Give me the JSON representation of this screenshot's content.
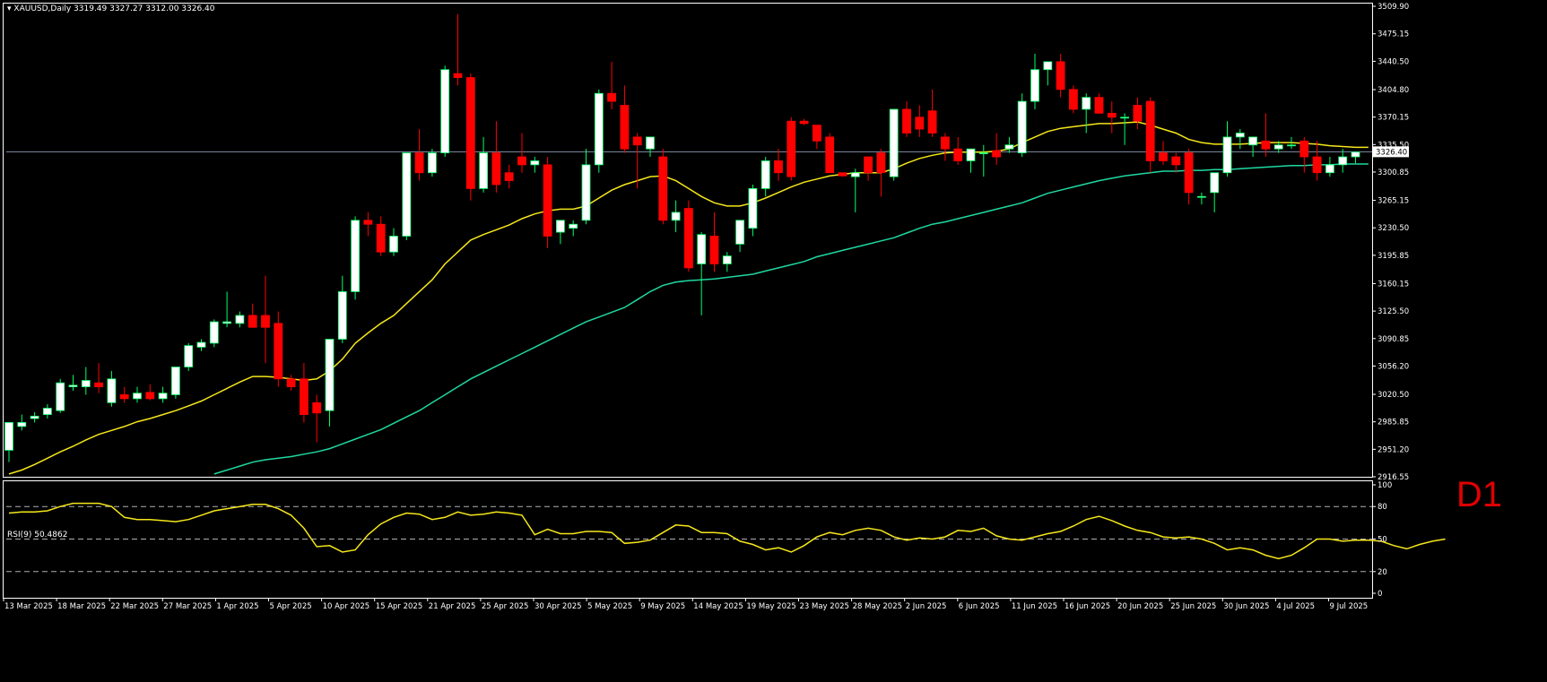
{
  "header": {
    "symbol_text": "XAUUSD,Daily  3319.49 3327.27 3312.00 3326.40"
  },
  "timeframe_label": "D1",
  "rsi": {
    "title": "RSI(9) 50.4862",
    "levels": [
      80,
      50,
      20
    ],
    "axis_labels": [
      "100",
      "80",
      "50",
      "20",
      "0"
    ],
    "color": "#f5e71a",
    "values": [
      74,
      75,
      75,
      76,
      80,
      83,
      83,
      83,
      80,
      70,
      68,
      68,
      67,
      66,
      68,
      72,
      76,
      78,
      80,
      82,
      82,
      78,
      72,
      60,
      43,
      44,
      38,
      40,
      54,
      64,
      70,
      74,
      73,
      68,
      70,
      75,
      72,
      73,
      75,
      74,
      72,
      54,
      59,
      55,
      55,
      57,
      57,
      56,
      46,
      47,
      49,
      56,
      63,
      62,
      56,
      56,
      55,
      48,
      45,
      40,
      42,
      38,
      44,
      52,
      56,
      54,
      58,
      60,
      58,
      52,
      49,
      51,
      50,
      52,
      58,
      57,
      60,
      53,
      50,
      49,
      52,
      55,
      57,
      62,
      68,
      71,
      67,
      62,
      58,
      56,
      52,
      51,
      52,
      50,
      46,
      40,
      42,
      40,
      35,
      32,
      35,
      42,
      50,
      50,
      48,
      49,
      49,
      48,
      44,
      41,
      45,
      48,
      50
    ]
  },
  "price_axis": {
    "ticks": [
      "3509.90",
      "3475.15",
      "3440.50",
      "3404.80",
      "3370.15",
      "3335.50",
      "3300.85",
      "3265.15",
      "3230.50",
      "3195.85",
      "3160.15",
      "3125.50",
      "3090.85",
      "3056.20",
      "3020.50",
      "2985.85",
      "2951.20",
      "2916.55"
    ],
    "current_price": "3326.40",
    "current_line_color": "#7f8fa6"
  },
  "date_axis": {
    "labels": [
      "13 Mar 2025",
      "18 Mar 2025",
      "22 Mar 2025",
      "27 Mar 2025",
      "1 Apr 2025",
      "5 Apr 2025",
      "10 Apr 2025",
      "15 Apr 2025",
      "21 Apr 2025",
      "25 Apr 2025",
      "30 Apr 2025",
      "5 May 2025",
      "9 May 2025",
      "14 May 2025",
      "19 May 2025",
      "23 May 2025",
      "28 May 2025",
      "2 Jun 2025",
      "6 Jun 2025",
      "11 Jun 2025",
      "16 Jun 2025",
      "20 Jun 2025",
      "25 Jun 2025",
      "30 Jun 2025",
      "4 Jul 2025",
      "9 Jul 2025"
    ]
  },
  "chart_data": {
    "type": "candlestick",
    "symbol": "XAUUSD",
    "period": "Daily",
    "ohlc_last": {
      "open": 3319.49,
      "high": 3327.27,
      "low": 3312.0,
      "close": 3326.4
    },
    "ylim": [
      2916.55,
      3509.9
    ],
    "colors": {
      "bull": "#ffffff",
      "bear": "#ff0000",
      "ma_fast": "#f5e71a",
      "ma_slow": "#1fd8a0"
    },
    "candles": [
      {
        "o": 2950,
        "h": 2970,
        "l": 2935,
        "c": 2985
      },
      {
        "o": 2980,
        "h": 2995,
        "l": 2975,
        "c": 2985
      },
      {
        "o": 2990,
        "h": 2998,
        "l": 2985,
        "c": 2993
      },
      {
        "o": 2995,
        "h": 3008,
        "l": 2990,
        "c": 3003
      },
      {
        "o": 3000,
        "h": 3040,
        "l": 2997,
        "c": 3035
      },
      {
        "o": 3030,
        "h": 3045,
        "l": 3025,
        "c": 3032
      },
      {
        "o": 3030,
        "h": 3055,
        "l": 3020,
        "c": 3038
      },
      {
        "o": 3035,
        "h": 3060,
        "l": 3022,
        "c": 3030
      },
      {
        "o": 3010,
        "h": 3050,
        "l": 3005,
        "c": 3040
      },
      {
        "o": 3020,
        "h": 3030,
        "l": 3010,
        "c": 3015
      },
      {
        "o": 3015,
        "h": 3030,
        "l": 3010,
        "c": 3022
      },
      {
        "o": 3023,
        "h": 3033,
        "l": 3013,
        "c": 3015
      },
      {
        "o": 3015,
        "h": 3030,
        "l": 3010,
        "c": 3022
      },
      {
        "o": 3020,
        "h": 3045,
        "l": 3015,
        "c": 3055
      },
      {
        "o": 3055,
        "h": 3085,
        "l": 3050,
        "c": 3082
      },
      {
        "o": 3080,
        "h": 3090,
        "l": 3075,
        "c": 3086
      },
      {
        "o": 3085,
        "h": 3115,
        "l": 3080,
        "c": 3112
      },
      {
        "o": 3110,
        "h": 3150,
        "l": 3105,
        "c": 3112
      },
      {
        "o": 3110,
        "h": 3125,
        "l": 3105,
        "c": 3120
      },
      {
        "o": 3120,
        "h": 3135,
        "l": 3110,
        "c": 3105
      },
      {
        "o": 3120,
        "h": 3170,
        "l": 3060,
        "c": 3105
      },
      {
        "o": 3110,
        "h": 3125,
        "l": 3030,
        "c": 3040
      },
      {
        "o": 3040,
        "h": 3045,
        "l": 3025,
        "c": 3030
      },
      {
        "o": 3040,
        "h": 3060,
        "l": 2985,
        "c": 2995
      },
      {
        "o": 3010,
        "h": 3020,
        "l": 2960,
        "c": 2997
      },
      {
        "o": 3000,
        "h": 3050,
        "l": 2980,
        "c": 3090
      },
      {
        "o": 3090,
        "h": 3170,
        "l": 3085,
        "c": 3150
      },
      {
        "o": 3150,
        "h": 3245,
        "l": 3140,
        "c": 3240
      },
      {
        "o": 3240,
        "h": 3250,
        "l": 3220,
        "c": 3235
      },
      {
        "o": 3235,
        "h": 3245,
        "l": 3195,
        "c": 3200
      },
      {
        "o": 3200,
        "h": 3230,
        "l": 3195,
        "c": 3220
      },
      {
        "o": 3220,
        "h": 3325,
        "l": 3215,
        "c": 3325
      },
      {
        "o": 3325,
        "h": 3355,
        "l": 3290,
        "c": 3300
      },
      {
        "o": 3300,
        "h": 3330,
        "l": 3295,
        "c": 3325
      },
      {
        "o": 3325,
        "h": 3435,
        "l": 3320,
        "c": 3430
      },
      {
        "o": 3425,
        "h": 3500,
        "l": 3410,
        "c": 3420
      },
      {
        "o": 3420,
        "h": 3425,
        "l": 3265,
        "c": 3280
      },
      {
        "o": 3280,
        "h": 3345,
        "l": 3275,
        "c": 3325
      },
      {
        "o": 3325,
        "h": 3365,
        "l": 3275,
        "c": 3285
      },
      {
        "o": 3300,
        "h": 3310,
        "l": 3280,
        "c": 3290
      },
      {
        "o": 3320,
        "h": 3350,
        "l": 3300,
        "c": 3310
      },
      {
        "o": 3310,
        "h": 3320,
        "l": 3300,
        "c": 3315
      },
      {
        "o": 3310,
        "h": 3320,
        "l": 3205,
        "c": 3220
      },
      {
        "o": 3225,
        "h": 3235,
        "l": 3210,
        "c": 3240
      },
      {
        "o": 3230,
        "h": 3240,
        "l": 3220,
        "c": 3235
      },
      {
        "o": 3240,
        "h": 3330,
        "l": 3235,
        "c": 3310
      },
      {
        "o": 3310,
        "h": 3405,
        "l": 3300,
        "c": 3400
      },
      {
        "o": 3400,
        "h": 3440,
        "l": 3380,
        "c": 3390
      },
      {
        "o": 3385,
        "h": 3410,
        "l": 3325,
        "c": 3330
      },
      {
        "o": 3345,
        "h": 3350,
        "l": 3280,
        "c": 3335
      },
      {
        "o": 3330,
        "h": 3345,
        "l": 3320,
        "c": 3345
      },
      {
        "o": 3320,
        "h": 3330,
        "l": 3235,
        "c": 3240
      },
      {
        "o": 3240,
        "h": 3265,
        "l": 3225,
        "c": 3250
      },
      {
        "o": 3255,
        "h": 3265,
        "l": 3175,
        "c": 3180
      },
      {
        "o": 3185,
        "h": 3225,
        "l": 3120,
        "c": 3222
      },
      {
        "o": 3220,
        "h": 3250,
        "l": 3175,
        "c": 3185
      },
      {
        "o": 3185,
        "h": 3200,
        "l": 3175,
        "c": 3195
      },
      {
        "o": 3210,
        "h": 3240,
        "l": 3200,
        "c": 3240
      },
      {
        "o": 3230,
        "h": 3285,
        "l": 3220,
        "c": 3280
      },
      {
        "o": 3280,
        "h": 3320,
        "l": 3270,
        "c": 3315
      },
      {
        "o": 3315,
        "h": 3330,
        "l": 3290,
        "c": 3300
      },
      {
        "o": 3365,
        "h": 3370,
        "l": 3290,
        "c": 3295
      },
      {
        "o": 3365,
        "h": 3368,
        "l": 3360,
        "c": 3362
      },
      {
        "o": 3360,
        "h": 3360,
        "l": 3330,
        "c": 3340
      },
      {
        "o": 3345,
        "h": 3350,
        "l": 3300,
        "c": 3300
      },
      {
        "o": 3300,
        "h": 3300,
        "l": 3295,
        "c": 3296
      },
      {
        "o": 3295,
        "h": 3305,
        "l": 3250,
        "c": 3300
      },
      {
        "o": 3320,
        "h": 3320,
        "l": 3290,
        "c": 3300
      },
      {
        "o": 3325,
        "h": 3330,
        "l": 3270,
        "c": 3300
      },
      {
        "o": 3295,
        "h": 3305,
        "l": 3290,
        "c": 3380
      },
      {
        "o": 3380,
        "h": 3390,
        "l": 3345,
        "c": 3350
      },
      {
        "o": 3370,
        "h": 3385,
        "l": 3345,
        "c": 3355
      },
      {
        "o": 3378,
        "h": 3405,
        "l": 3345,
        "c": 3350
      },
      {
        "o": 3345,
        "h": 3350,
        "l": 3315,
        "c": 3330
      },
      {
        "o": 3330,
        "h": 3345,
        "l": 3310,
        "c": 3315
      },
      {
        "o": 3315,
        "h": 3325,
        "l": 3300,
        "c": 3330
      },
      {
        "o": 3325,
        "h": 3335,
        "l": 3295,
        "c": 3325
      },
      {
        "o": 3328,
        "h": 3350,
        "l": 3310,
        "c": 3320
      },
      {
        "o": 3330,
        "h": 3345,
        "l": 3325,
        "c": 3335
      },
      {
        "o": 3325,
        "h": 3400,
        "l": 3320,
        "c": 3390
      },
      {
        "o": 3390,
        "h": 3450,
        "l": 3380,
        "c": 3430
      },
      {
        "o": 3430,
        "h": 3440,
        "l": 3410,
        "c": 3440
      },
      {
        "o": 3440,
        "h": 3450,
        "l": 3395,
        "c": 3405
      },
      {
        "o": 3405,
        "h": 3410,
        "l": 3375,
        "c": 3380
      },
      {
        "o": 3380,
        "h": 3400,
        "l": 3350,
        "c": 3395
      },
      {
        "o": 3395,
        "h": 3400,
        "l": 3375,
        "c": 3375
      },
      {
        "o": 3375,
        "h": 3390,
        "l": 3350,
        "c": 3370
      },
      {
        "o": 3370,
        "h": 3375,
        "l": 3335,
        "c": 3370
      },
      {
        "o": 3385,
        "h": 3395,
        "l": 3355,
        "c": 3365
      },
      {
        "o": 3390,
        "h": 3395,
        "l": 3300,
        "c": 3315
      },
      {
        "o": 3325,
        "h": 3340,
        "l": 3310,
        "c": 3315
      },
      {
        "o": 3320,
        "h": 3325,
        "l": 3300,
        "c": 3310
      },
      {
        "o": 3325,
        "h": 3330,
        "l": 3260,
        "c": 3275
      },
      {
        "o": 3270,
        "h": 3275,
        "l": 3260,
        "c": 3270
      },
      {
        "o": 3275,
        "h": 3300,
        "l": 3250,
        "c": 3300
      },
      {
        "o": 3300,
        "h": 3365,
        "l": 3295,
        "c": 3345
      },
      {
        "o": 3345,
        "h": 3355,
        "l": 3330,
        "c": 3350
      },
      {
        "o": 3335,
        "h": 3345,
        "l": 3320,
        "c": 3345
      },
      {
        "o": 3340,
        "h": 3375,
        "l": 3320,
        "c": 3330
      },
      {
        "o": 3330,
        "h": 3340,
        "l": 3325,
        "c": 3335
      },
      {
        "o": 3335,
        "h": 3345,
        "l": 3330,
        "c": 3335
      },
      {
        "o": 3340,
        "h": 3345,
        "l": 3300,
        "c": 3320
      },
      {
        "o": 3320,
        "h": 3340,
        "l": 3290,
        "c": 3300
      },
      {
        "o": 3300,
        "h": 3320,
        "l": 3295,
        "c": 3310
      },
      {
        "o": 3310,
        "h": 3330,
        "l": 3300,
        "c": 3320
      },
      {
        "o": 3320,
        "h": 3327,
        "l": 3312,
        "c": 3326
      }
    ],
    "ma_fast": [
      2920,
      2925,
      2932,
      2940,
      2948,
      2955,
      2963,
      2970,
      2975,
      2980,
      2986,
      2990,
      2995,
      3000,
      3006,
      3012,
      3020,
      3028,
      3036,
      3043,
      3043,
      3042,
      3040,
      3038,
      3040,
      3050,
      3065,
      3085,
      3098,
      3110,
      3120,
      3135,
      3150,
      3165,
      3185,
      3200,
      3215,
      3222,
      3228,
      3234,
      3242,
      3248,
      3252,
      3254,
      3254,
      3258,
      3268,
      3278,
      3285,
      3290,
      3295,
      3296,
      3290,
      3280,
      3270,
      3262,
      3258,
      3258,
      3262,
      3268,
      3275,
      3282,
      3288,
      3292,
      3296,
      3298,
      3300,
      3300,
      3300,
      3305,
      3312,
      3318,
      3322,
      3325,
      3326,
      3326,
      3326,
      3327,
      3330,
      3338,
      3345,
      3352,
      3356,
      3358,
      3360,
      3362,
      3362,
      3363,
      3364,
      3360,
      3355,
      3350,
      3342,
      3338,
      3336,
      3336,
      3336,
      3337,
      3338,
      3338,
      3338,
      3337,
      3336,
      3334,
      3333,
      3332,
      3332
    ],
    "ma_slow": [
      2880,
      2882,
      2884,
      2886,
      2888,
      2890,
      2892,
      2895,
      2898,
      2900,
      2903,
      2906,
      2908,
      2911,
      2913,
      2916,
      2920,
      2925,
      2930,
      2935,
      2938,
      2940,
      2942,
      2945,
      2948,
      2952,
      2958,
      2964,
      2970,
      2976,
      2984,
      2992,
      3000,
      3010,
      3020,
      3030,
      3040,
      3048,
      3056,
      3064,
      3072,
      3080,
      3088,
      3096,
      3104,
      3112,
      3118,
      3124,
      3130,
      3140,
      3150,
      3158,
      3162,
      3164,
      3165,
      3166,
      3168,
      3170,
      3172,
      3176,
      3180,
      3184,
      3188,
      3194,
      3198,
      3202,
      3206,
      3210,
      3214,
      3218,
      3224,
      3230,
      3235,
      3238,
      3242,
      3246,
      3250,
      3254,
      3258,
      3262,
      3268,
      3274,
      3278,
      3282,
      3286,
      3290,
      3293,
      3296,
      3298,
      3300,
      3302,
      3302,
      3303,
      3303,
      3304,
      3304,
      3305,
      3306,
      3307,
      3308,
      3309,
      3309,
      3310,
      3310,
      3311,
      3311,
      3311
    ]
  }
}
